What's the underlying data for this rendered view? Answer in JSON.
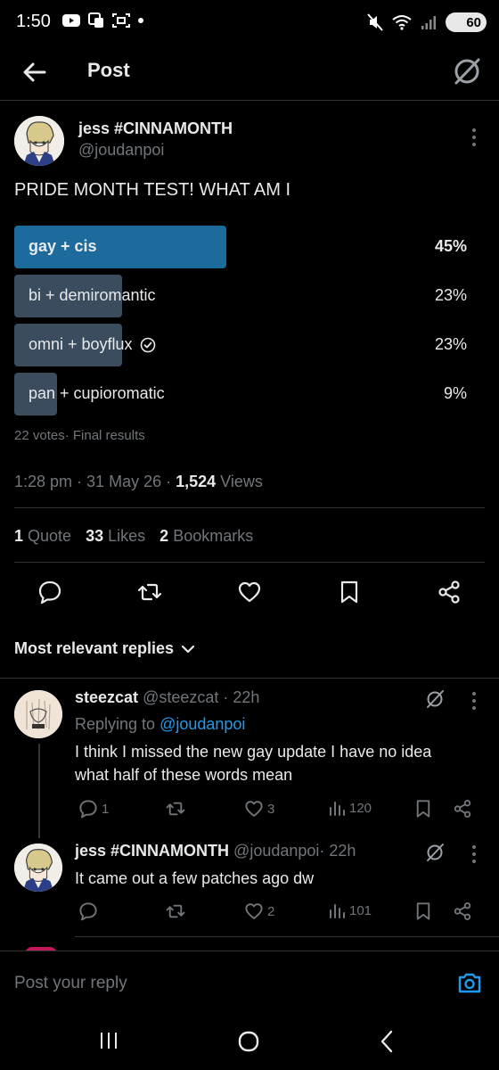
{
  "status_bar": {
    "time": "1:50",
    "battery": "60"
  },
  "header": {
    "title": "Post",
    "back_icon": "arrow-left-icon",
    "grok_icon": "grok-icon"
  },
  "post": {
    "author": {
      "display_name": "jess #CINNAMONTH",
      "handle": "@joudanpoi"
    },
    "text": "PRIDE MONTH TEST! WHAT AM I",
    "poll": {
      "options": [
        {
          "label": "gay + cis",
          "percent_text": "45%",
          "fraction": 0.45,
          "winner": true,
          "checked": false
        },
        {
          "label": "bi + demiromantic",
          "percent_text": "23%",
          "fraction": 0.23,
          "winner": false,
          "checked": false
        },
        {
          "label": "omni + boyflux",
          "percent_text": "23%",
          "fraction": 0.23,
          "winner": false,
          "checked": true
        },
        {
          "label": "pan + cupioromatic",
          "percent_text": "9%",
          "fraction": 0.09,
          "winner": false,
          "checked": false
        }
      ],
      "votes": "22 votes",
      "status": "· Final results"
    },
    "timestamp": {
      "time": "1:28 pm",
      "date": "31 May 26",
      "views_count": "1,524",
      "views_label": "Views"
    },
    "stats": {
      "quotes_count": "1",
      "quotes_label": "Quote",
      "likes_count": "33",
      "likes_label": "Likes",
      "bookmarks_count": "2",
      "bookmarks_label": "Bookmarks"
    }
  },
  "replies_sort_label": "Most relevant replies",
  "replies": [
    {
      "display_name": "steezcat",
      "handle": "@steezcat",
      "time": "· 22h",
      "replying_to_label": "Replying to",
      "replying_to_handle": "@joudanpoi",
      "text_line1": "I think I missed the new gay update I have no idea",
      "text_line2": "what half of these words mean",
      "replies_count": "1",
      "retweets_count": "",
      "likes_count": "3",
      "views_count": "120"
    },
    {
      "display_name": "jess #CINNAMONTH",
      "handle": "@joudanpoi",
      "time": "· 22h",
      "text_line1": "It came out a few patches ago dw",
      "replies_count": "",
      "retweets_count": "",
      "likes_count": "2",
      "views_count": "101"
    }
  ],
  "composer": {
    "placeholder": "Post your reply"
  },
  "colors": {
    "background": "#000000",
    "text": "#e7e9ea",
    "muted": "#71767b",
    "link": "#1d9bf0",
    "poll_winner": "#1d6a9c",
    "poll_other": "#3a4c5e"
  }
}
